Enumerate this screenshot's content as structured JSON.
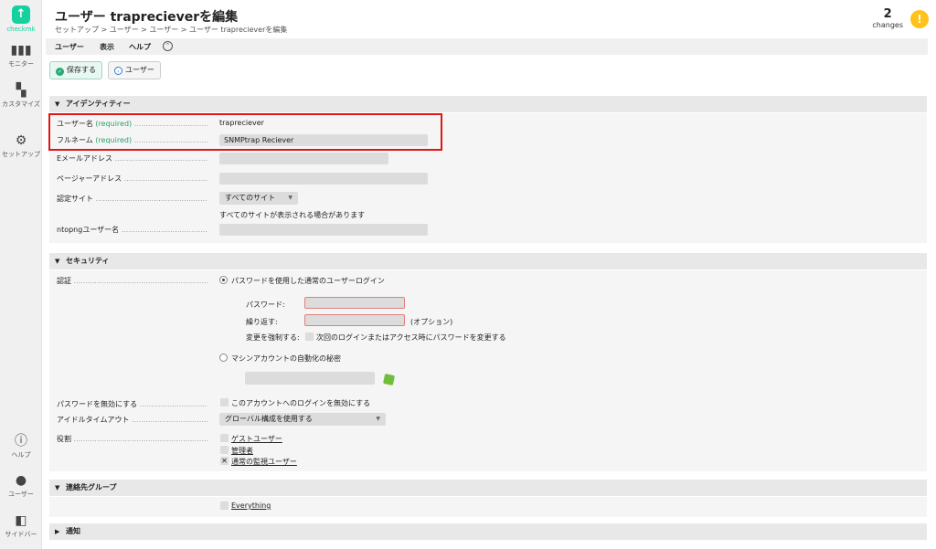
{
  "sidebar": {
    "logo_text": "checkmk",
    "items": [
      {
        "label": "モニター",
        "icon": "chart-icon"
      },
      {
        "label": "カスタマイズ",
        "icon": "grid-icon"
      },
      {
        "label": "セットアップ",
        "icon": "gear-icon"
      },
      {
        "label": "ヘルプ",
        "icon": "info-icon"
      },
      {
        "label": "ユーザー",
        "icon": "user-icon"
      },
      {
        "label": "サイドバー",
        "icon": "sidebar-icon"
      }
    ]
  },
  "header": {
    "title": "ユーザー traprecieverを編集",
    "breadcrumb": "セットアップ > ユーザー > ユーザー > ユーザー traprecieverを編集",
    "changes_count": "2",
    "changes_label": "changes"
  },
  "menubar": {
    "user": "ユーザー",
    "display": "表示",
    "help": "ヘルプ"
  },
  "toolbar": {
    "save_label": "保存する",
    "users_label": "ユーザー"
  },
  "identity": {
    "heading": "アイデンティティー",
    "username_label": "ユーザー名",
    "required": "(required)",
    "username_value": "trapreciever",
    "fullname_label": "フルネーム",
    "fullname_value": "SNMPtrap Reciever",
    "email_label": "Eメールアドレス",
    "pager_label": "ページャーアドレス",
    "site_label": "認定サイト",
    "site_value": "すべてのサイト",
    "site_note": "すべてのサイトが表示される場合があります",
    "ntopng_label": "ntopngユーザー名"
  },
  "security": {
    "heading": "セキュリティ",
    "auth_label": "認証",
    "normal_login": "パスワードを使用した通常のユーザーログイン",
    "password_label": "パスワード:",
    "repeat_label": "繰り返す:",
    "optional": "(オプション)",
    "force_label": "変更を強制する:",
    "force_text": "次回のログインまたはアクセス時にパスワードを変更する",
    "machine_secret": "マシンアカウントの自動化の秘密",
    "disable_label": "パスワードを無効にする",
    "disable_text": "このアカウントへのログインを無効にする",
    "idle_label": "アイドルタイムアウト",
    "idle_value": "グローバル構成を使用する",
    "roles_label": "役割",
    "roles": [
      "ゲストユーザー",
      "管理者",
      "通常の監視ユーザー"
    ]
  },
  "contact_groups": {
    "heading": "連絡先グループ",
    "item": "Everything"
  },
  "notifications": {
    "heading": "通知"
  }
}
